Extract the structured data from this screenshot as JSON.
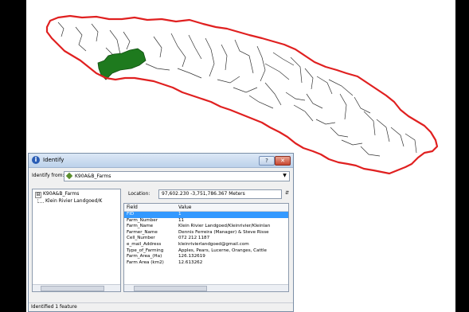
{
  "window": {
    "title": "Identify",
    "title_icon": "info-icon",
    "help_label": "?",
    "close_label": "✕"
  },
  "identify_from": {
    "label": "Identify from:",
    "selected": "K90A&B_Farms",
    "icon": "layer-icon"
  },
  "tree": {
    "expander": "⊟",
    "root": "K90A&B_Farms",
    "child": "Klein Rivier Landgoed/K"
  },
  "location": {
    "label": "Location:",
    "value": "97,602.230  -3,751,786.367 Meters"
  },
  "attributes": {
    "columns": [
      "Field",
      "Value"
    ],
    "rows": [
      {
        "field": "FID",
        "value": "1"
      },
      {
        "field": "Farm_Number",
        "value": "11"
      },
      {
        "field": "Farm_Name",
        "value": "Klein Rivier Landgoed/Kleinrivier/Kleinlan"
      },
      {
        "field": "Farmer_Name",
        "value": "Dennis Ferreira (Manager) & Steve Risse"
      },
      {
        "field": "Cell_Number",
        "value": "072 212 1187"
      },
      {
        "field": "e_mail_Address",
        "value": "kleinrivierlandgoed@gmail.com"
      },
      {
        "field": "Type_of_Farming",
        "value": "Apples, Pears, Lucerne, Oranges, Cattle"
      },
      {
        "field": "Farm_Area_(Ha)",
        "value": "126.132619"
      },
      {
        "field": "Farm Area (km2)",
        "value": "12.613262"
      }
    ]
  },
  "status": "Identified 1 feature",
  "colors": {
    "boundary": "#e02020",
    "selected_parcel": "#1e7a1e",
    "parcel_lines": "#333333",
    "selected_row": "#3399ff"
  }
}
